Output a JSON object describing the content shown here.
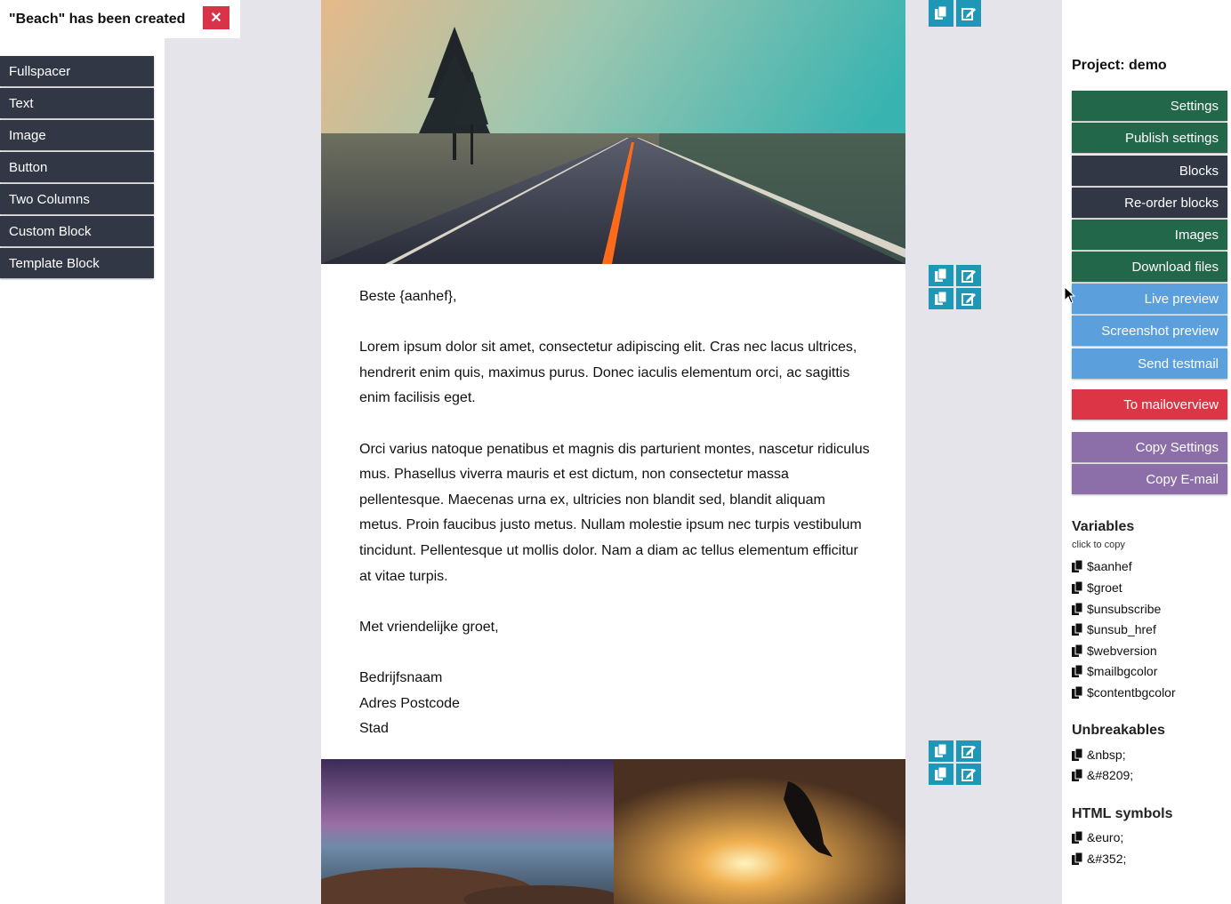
{
  "notice": {
    "text": "\"Beach\" has been created",
    "close": "✕"
  },
  "blocks": [
    "Fullspacer",
    "Text",
    "Image",
    "Button",
    "Two Columns",
    "Custom Block",
    "Template Block"
  ],
  "email": {
    "greeting": "Beste {aanhef},",
    "para1": "Lorem ipsum dolor sit amet, consectetur adipiscing elit. Cras nec lacus ultrices, hendrerit enim quis, maximus purus. Donec iaculis elementum orci, ac sagittis enim facilisis eget.",
    "para2": "Orci varius natoque penatibus et magnis dis parturient montes, nascetur ridiculus mus. Phasellus viverra mauris et est dictum, non consectetur massa pellentesque. Maecenas urna ex, ultricies non blandit sed, blandit aliquam metus. Proin faucibus justo metus. Nullam molestie ipsum nec turpis vestibulum tincidunt. Pellentesque ut mollis dolor. Nam a diam ac tellus elementum efficitur at vitae turpis.",
    "closing": "Met vriendelijke groet,",
    "company": "Bedrijfsnaam",
    "address": "Adres Postcode",
    "city": "Stad"
  },
  "panel": {
    "project": "Project: demo",
    "buttons": [
      {
        "label": "Settings",
        "color": "#22674a"
      },
      {
        "label": "Publish settings",
        "color": "#22674a"
      },
      {
        "label": "Blocks",
        "color": "#313744"
      },
      {
        "label": "Re-order blocks",
        "color": "#313744"
      },
      {
        "label": "Images",
        "color": "#22674a"
      },
      {
        "label": "Download files",
        "color": "#22674a"
      },
      {
        "label": "Live preview",
        "color": "#5b9fdc"
      },
      {
        "label": "Screenshot preview",
        "color": "#5b9fdc"
      },
      {
        "label": "Send testmail",
        "color": "#5b9fdc"
      },
      {
        "label": "To mailoverview",
        "color": "#dc3545"
      },
      {
        "label": "Copy Settings",
        "color": "#8c6fa8"
      },
      {
        "label": "Copy E-mail",
        "color": "#8c6fa8"
      }
    ],
    "variables_title": "Variables",
    "variables_hint": "click to copy",
    "variables": [
      "$aanhef",
      "$groet",
      "$unsubscribe",
      "$unsub_href",
      "$webversion",
      "$mailbgcolor",
      "$contentbgcolor"
    ],
    "unbreakables_title": "Unbreakables",
    "unbreakables": [
      "&nbsp;",
      "&#8209;"
    ],
    "symbols_title": "HTML symbols",
    "symbols": [
      "&euro;",
      "&#352;"
    ]
  },
  "icons": {
    "copy": "copy-icon",
    "edit": "edit-icon",
    "cursor": "mouse-pointer-icon"
  }
}
